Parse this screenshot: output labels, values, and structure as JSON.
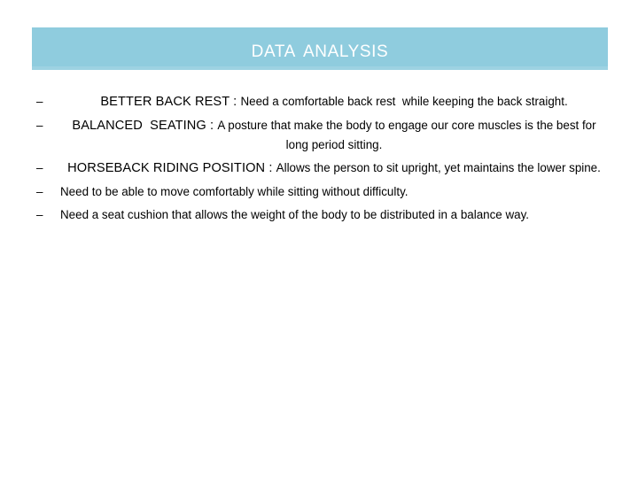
{
  "slide": {
    "title": "Data Analysis",
    "banner_color": "#8fccde",
    "title_color": "#ffffff",
    "background_color": "#ffffff",
    "text_color": "#000000",
    "bullet_marker": "–"
  },
  "bullets": [
    {
      "marker": "–",
      "term": "BETTER BACK REST",
      "separator": " : ",
      "body": "Need a comfortable back rest  while keeping the back straight.",
      "align": "center"
    },
    {
      "marker": "–",
      "term": "BALANCED  SEATING",
      "separator": " : ",
      "body": "A posture that make the body to engage our core muscles is the best for long period sitting.",
      "align": "center"
    },
    {
      "marker": "–",
      "term": "HORSEBACK RIDING POSITION",
      "separator": " : ",
      "body": "Allows the person to sit upright, yet maintains the lower spine.",
      "align": "center"
    },
    {
      "marker": "–",
      "term": "",
      "separator": "",
      "body": "Need to be able to move comfortably while sitting without difficulty.",
      "align": "left"
    },
    {
      "marker": "–",
      "term": "",
      "separator": "",
      "body": "Need a seat cushion that allows the weight of the body to be distributed in a balance way.",
      "align": "left"
    }
  ]
}
